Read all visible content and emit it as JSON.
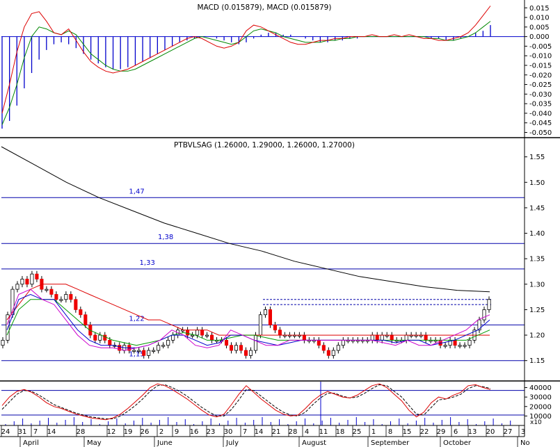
{
  "chart_data": [
    {
      "type": "bar",
      "title": "MACD (0.015879), MACD (0.015879)",
      "ylim": [
        -0.052,
        0.018
      ],
      "yticks": [
        "0.015",
        "0.010",
        "0.005",
        "0.000",
        "-0.005",
        "-0.010",
        "-0.015",
        "-0.020",
        "-0.025",
        "-0.030",
        "-0.035",
        "-0.040",
        "-0.045",
        "-0.050"
      ],
      "ytick_values": [
        0.015,
        0.01,
        0.005,
        0.0,
        -0.005,
        -0.01,
        -0.015,
        -0.02,
        -0.025,
        -0.03,
        -0.035,
        -0.04,
        -0.045,
        -0.05
      ],
      "grid": false,
      "series": [
        {
          "role": "histogram",
          "color": "#0000cc",
          "values": [
            -0.048,
            -0.044,
            -0.036,
            -0.027,
            -0.019,
            -0.012,
            -0.007,
            -0.004,
            -0.003,
            -0.004,
            -0.006,
            -0.009,
            -0.012,
            -0.014,
            -0.016,
            -0.017,
            -0.017,
            -0.016,
            -0.015,
            -0.013,
            -0.011,
            -0.009,
            -0.007,
            -0.005,
            -0.003,
            -0.002,
            -0.001,
            0.0,
            0.0,
            -0.001,
            -0.002,
            -0.003,
            -0.004,
            -0.003,
            -0.001,
            0.001,
            0.002,
            0.002,
            0.001,
            0.001,
            0.0,
            -0.001,
            -0.002,
            -0.003,
            -0.003,
            -0.002,
            -0.002,
            -0.001,
            -0.001,
            0.0,
            0.0,
            0.0,
            0.0,
            0.0,
            0.0,
            0.0,
            0.0,
            0.0,
            -0.001,
            -0.001,
            -0.002,
            -0.002,
            -0.001,
            0.0,
            0.002,
            0.003,
            0.006
          ]
        },
        {
          "role": "macd",
          "color": "#dd0000",
          "values": [
            -0.04,
            -0.025,
            -0.008,
            0.005,
            0.012,
            0.013,
            0.008,
            0.002,
            0.001,
            0.004,
            -0.002,
            -0.008,
            -0.013,
            -0.016,
            -0.018,
            -0.019,
            -0.018,
            -0.017,
            -0.015,
            -0.013,
            -0.011,
            -0.009,
            -0.007,
            -0.005,
            -0.003,
            -0.001,
            0.0,
            -0.001,
            -0.003,
            -0.005,
            -0.006,
            -0.005,
            -0.003,
            0.003,
            0.006,
            0.005,
            0.003,
            0.001,
            -0.001,
            -0.003,
            -0.004,
            -0.004,
            -0.003,
            -0.002,
            -0.002,
            -0.001,
            -0.001,
            0.0,
            0.0,
            0.0,
            0.001,
            0.0,
            0.0,
            0.001,
            0.0,
            0.001,
            0.0,
            -0.001,
            -0.001,
            -0.002,
            -0.002,
            -0.001,
            0.0,
            0.002,
            0.006,
            0.011,
            0.016
          ]
        },
        {
          "role": "signal",
          "color": "#008800",
          "values": [
            -0.046,
            -0.037,
            -0.025,
            -0.011,
            0.0,
            0.005,
            0.004,
            0.002,
            0.001,
            0.003,
            0.001,
            -0.004,
            -0.009,
            -0.012,
            -0.015,
            -0.017,
            -0.018,
            -0.018,
            -0.017,
            -0.015,
            -0.013,
            -0.011,
            -0.009,
            -0.007,
            -0.005,
            -0.003,
            -0.001,
            0.0,
            -0.001,
            -0.002,
            -0.003,
            -0.004,
            -0.003,
            0.0,
            0.003,
            0.004,
            0.003,
            0.002,
            0.0,
            -0.001,
            -0.002,
            -0.003,
            -0.003,
            -0.003,
            -0.002,
            -0.002,
            -0.001,
            -0.001,
            0.0,
            0.0,
            0.0,
            0.0,
            0.0,
            0.0,
            0.0,
            0.0,
            0.0,
            0.0,
            -0.001,
            -0.001,
            -0.002,
            -0.002,
            -0.001,
            0.0,
            0.002,
            0.005,
            0.008
          ]
        }
      ]
    },
    {
      "type": "candlestick",
      "title": "PTBVLSAG (1.26000, 1.29000, 1.26000, 1.27000)",
      "ylim": [
        1.11,
        1.585
      ],
      "yticks": [
        "1.55",
        "1.50",
        "1.45",
        "1.40",
        "1.35",
        "1.30",
        "1.25",
        "1.20",
        "1.15"
      ],
      "ytick_values": [
        1.55,
        1.5,
        1.45,
        1.4,
        1.35,
        1.3,
        1.25,
        1.2,
        1.15
      ],
      "grid": false,
      "levels": [
        {
          "value": 1.47,
          "label": "1,47",
          "label_x": 52
        },
        {
          "value": 1.38,
          "label": "1,38",
          "label_x": 63
        },
        {
          "value": 1.33,
          "label": "1,33",
          "label_x": 56
        },
        {
          "value": 1.22,
          "label": "1,22",
          "label_x": 52
        },
        {
          "value": 1.15,
          "label": "1,15",
          "label_x": 52
        }
      ],
      "close": [
        1.19,
        1.24,
        1.29,
        1.3,
        1.31,
        1.3,
        1.32,
        1.31,
        1.29,
        1.29,
        1.28,
        1.27,
        1.27,
        1.28,
        1.27,
        1.25,
        1.24,
        1.22,
        1.2,
        1.19,
        1.2,
        1.19,
        1.18,
        1.18,
        1.17,
        1.18,
        1.17,
        1.17,
        1.17,
        1.16,
        1.17,
        1.17,
        1.18,
        1.18,
        1.19,
        1.2,
        1.21,
        1.21,
        1.2,
        1.2,
        1.21,
        1.2,
        1.2,
        1.19,
        1.19,
        1.19,
        1.18,
        1.17,
        1.18,
        1.17,
        1.16,
        1.17,
        1.2,
        1.24,
        1.25,
        1.22,
        1.21,
        1.2,
        1.2,
        1.2,
        1.2,
        1.2,
        1.19,
        1.19,
        1.19,
        1.18,
        1.17,
        1.16,
        1.17,
        1.18,
        1.19,
        1.19,
        1.19,
        1.19,
        1.19,
        1.19,
        1.2,
        1.19,
        1.2,
        1.2,
        1.19,
        1.19,
        1.19,
        1.2,
        1.2,
        1.2,
        1.2,
        1.19,
        1.19,
        1.19,
        1.18,
        1.18,
        1.19,
        1.18,
        1.18,
        1.18,
        1.19,
        1.21,
        1.23,
        1.25,
        1.27
      ],
      "series": [
        {
          "name": "",
          "color": "#000000",
          "values": [
            1.57,
            1.535,
            1.5,
            1.47,
            1.445,
            1.42,
            1.4,
            1.38,
            1.365,
            1.345,
            1.33,
            1.315,
            1.305,
            1.295,
            1.288,
            1.285
          ]
        },
        {
          "name": "",
          "color": "#dd0000",
          "values": [
            1.23,
            1.26,
            1.29,
            1.3,
            1.3,
            1.3,
            1.29,
            1.28,
            1.27,
            1.26,
            1.25,
            1.24,
            1.23,
            1.23,
            1.22,
            1.21,
            1.21,
            1.21,
            1.2,
            1.2,
            1.2,
            1.2,
            1.2,
            1.2,
            1.2,
            1.2,
            1.2,
            1.2,
            1.2,
            1.2,
            1.2,
            1.2,
            1.2,
            1.2,
            1.2,
            1.2,
            1.2,
            1.2,
            1.2,
            1.2,
            1.2,
            1.2
          ]
        },
        {
          "name": "",
          "color": "#009900",
          "values": [
            1.2,
            1.25,
            1.27,
            1.27,
            1.27,
            1.25,
            1.23,
            1.21,
            1.2,
            1.19,
            1.185,
            1.18,
            1.185,
            1.19,
            1.2,
            1.205,
            1.2,
            1.19,
            1.19,
            1.195,
            1.2,
            1.2,
            1.195,
            1.19,
            1.19,
            1.19,
            1.19,
            1.19,
            1.19,
            1.19,
            1.19,
            1.19,
            1.19,
            1.19,
            1.19,
            1.19,
            1.19,
            1.19,
            1.19,
            1.19,
            1.2,
            1.21
          ]
        },
        {
          "name": "",
          "color": "#0000cc",
          "values": [
            1.21,
            1.27,
            1.28,
            1.27,
            1.27,
            1.24,
            1.21,
            1.19,
            1.18,
            1.18,
            1.175,
            1.175,
            1.18,
            1.19,
            1.2,
            1.2,
            1.19,
            1.18,
            1.185,
            1.2,
            1.2,
            1.19,
            1.185,
            1.18,
            1.185,
            1.19,
            1.19,
            1.19,
            1.19,
            1.19,
            1.19,
            1.19,
            1.19,
            1.185,
            1.19,
            1.19,
            1.18,
            1.185,
            1.19,
            1.2,
            1.21,
            1.23
          ]
        },
        {
          "name": "",
          "color": "#cc00cc",
          "values": [
            1.22,
            1.28,
            1.29,
            1.27,
            1.26,
            1.23,
            1.2,
            1.18,
            1.175,
            1.175,
            1.17,
            1.175,
            1.18,
            1.19,
            1.21,
            1.2,
            1.18,
            1.175,
            1.18,
            1.21,
            1.2,
            1.19,
            1.18,
            1.18,
            1.19,
            1.19,
            1.19,
            1.19,
            1.19,
            1.19,
            1.19,
            1.19,
            1.185,
            1.18,
            1.19,
            1.18,
            1.18,
            1.19,
            1.2,
            1.21,
            1.23,
            1.24
          ]
        }
      ]
    },
    {
      "type": "line",
      "ylim": [
        0,
        47000
      ],
      "yticks": [
        "40000",
        "30000",
        "20000",
        "10000"
      ],
      "ytick_values": [
        40000,
        30000,
        20000,
        10000
      ],
      "ylabel_multiplier": "x10",
      "levels": [
        {
          "value": 37000
        },
        {
          "value": 11000
        }
      ],
      "grid": false,
      "series": [
        {
          "name": "",
          "color": "#dd0000",
          "values": [
            21000,
            30000,
            36000,
            38000,
            35000,
            30000,
            24000,
            20000,
            18000,
            15000,
            12000,
            10000,
            8000,
            7000,
            6000,
            8000,
            12000,
            18000,
            25000,
            32000,
            40000,
            44000,
            42000,
            38000,
            33000,
            28000,
            22000,
            16000,
            11000,
            9000,
            12000,
            22000,
            33000,
            42000,
            35000,
            28000,
            22000,
            16000,
            12000,
            10000,
            11000,
            18000,
            26000,
            32000,
            36000,
            33000,
            30000,
            29000,
            32000,
            37000,
            42000,
            44000,
            40000,
            33000,
            26000,
            16000,
            9000,
            14000,
            24000,
            30000,
            28000,
            32000,
            35000,
            42000,
            43000,
            40000,
            38000
          ]
        },
        {
          "name": "",
          "color": "#000000",
          "values": [
            17000,
            25000,
            33000,
            37000,
            36000,
            32000,
            27000,
            22000,
            19000,
            16000,
            13000,
            11000,
            9000,
            8000,
            7000,
            7000,
            10000,
            15000,
            21000,
            28000,
            36000,
            42000,
            43000,
            40000,
            36000,
            31000,
            25000,
            19000,
            14000,
            10000,
            10000,
            17000,
            27000,
            38000,
            37000,
            31000,
            25000,
            19000,
            14000,
            11000,
            10000,
            14000,
            22000,
            29000,
            34000,
            34000,
            31000,
            29000,
            30000,
            34000,
            39000,
            43000,
            42000,
            36000,
            30000,
            21000,
            12000,
            11000,
            19000,
            27000,
            28000,
            30000,
            33000,
            39000,
            42000,
            41000,
            39000
          ]
        }
      ]
    }
  ],
  "x_axis": {
    "day_labels": [
      "24",
      "31",
      "7",
      "14",
      "28",
      "12",
      "19",
      "26",
      "2",
      "9",
      "16",
      "23",
      "30",
      "7",
      "14",
      "21",
      "28",
      "4",
      "11",
      "18",
      "25",
      "1",
      "8",
      "15",
      "22",
      "29",
      "6",
      "13",
      "20",
      "27",
      "3"
    ],
    "month_labels": [
      "April",
      "May",
      "June",
      "July",
      "August",
      "September",
      "October",
      "No"
    ]
  }
}
